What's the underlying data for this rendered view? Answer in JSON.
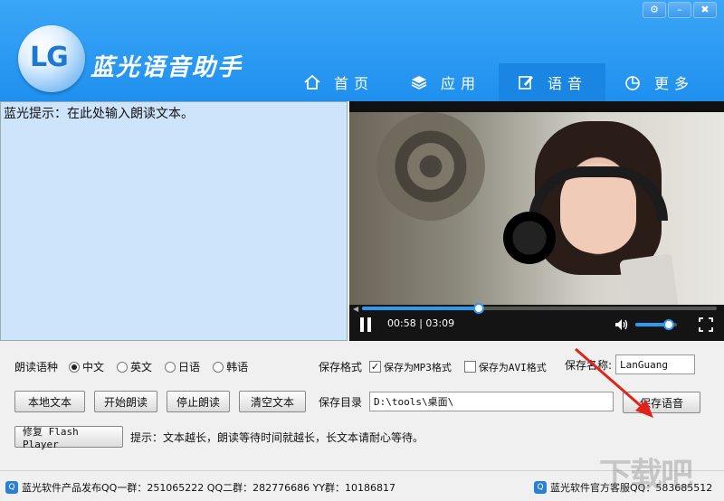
{
  "window": {
    "min_label": "–",
    "close_label": "✖",
    "settings_label": "⚙"
  },
  "app": {
    "title": "蓝光语音助手",
    "logo_text": "LG"
  },
  "nav": [
    {
      "label": "首页",
      "icon": "home-icon"
    },
    {
      "label": "应用",
      "icon": "layers-icon"
    },
    {
      "label": "语音",
      "icon": "edit-icon",
      "active": true
    },
    {
      "label": "更多",
      "icon": "pie-icon"
    }
  ],
  "editor": {
    "text": "蓝光提示：在此处输入朗读文本。"
  },
  "video": {
    "current": "00:58",
    "separator": "|",
    "total": "03:09",
    "progress": 0.33,
    "volume": 0.8
  },
  "controls": {
    "language_label": "朗读语种",
    "languages": [
      {
        "label": "中文",
        "selected": true
      },
      {
        "label": "英文",
        "selected": false
      },
      {
        "label": "日语",
        "selected": false
      },
      {
        "label": "韩语",
        "selected": false
      }
    ],
    "format_label": "保存格式",
    "formats": [
      {
        "label": "保存为MP3格式",
        "checked": true
      },
      {
        "label": "保存为AVI格式",
        "checked": false
      }
    ],
    "name_label": "保存名称:",
    "name_value": "LanGuang",
    "dir_label": "保存目录",
    "dir_value": "D:\\tools\\桌面\\",
    "buttons": {
      "local_text": "本地文本",
      "start_read": "开始朗读",
      "stop_read": "停止朗读",
      "clear_text": "清空文本",
      "save_voice": "保存语音",
      "repair_flash": "修复 Flash Player"
    },
    "hint": "提示：文本越长，朗读等待时间就越长，长文本请耐心等待。"
  },
  "status": {
    "left": "蓝光软件产品发布QQ一群：251065222  QQ二群：282776686  YY群：10186817",
    "right": "蓝光软件官方客服QQ：583685512"
  },
  "watermark": "下载吧",
  "colors": {
    "accent": "#2b9af3",
    "editor_bg": "#cde4fb"
  }
}
